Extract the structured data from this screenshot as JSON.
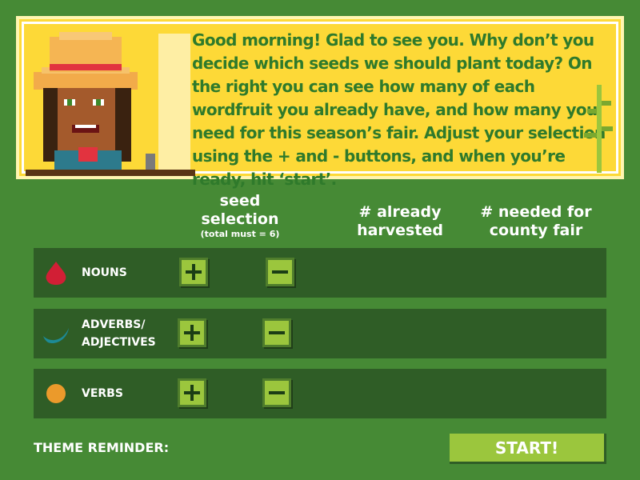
{
  "dialog": {
    "text": "Good morning! Glad to see you. Why don’t you decide which seeds we should plant today?  On the right you can see how many of each wordfruit you already have, and how many you need for this season’s fair. Adjust your selection using the + and - buttons, and when you’re ready, hit ‘start’."
  },
  "columns": {
    "seed_line1": "seed",
    "seed_line2": "selection",
    "seed_note": "(total must = 6)",
    "harvested_line1": "# already",
    "harvested_line2": "harvested",
    "needed_line1": "# needed for",
    "needed_line2": "county fair"
  },
  "rows": [
    {
      "label": "NOUNS",
      "icon": "red-drop-icon",
      "color": "#d11f35"
    },
    {
      "label_line1": "ADVERBS/",
      "label_line2": "ADJECTIVES",
      "icon": "teal-crescent-icon",
      "color": "#1d8a96"
    },
    {
      "label": "VERBS",
      "icon": "orange-circle-icon",
      "color": "#eb9a2b"
    }
  ],
  "controls": {
    "plus_icon": "plus-icon",
    "minus_icon": "minus-icon"
  },
  "footer": {
    "theme_label": "THEME REMINDER:",
    "start_label": "START!"
  },
  "colors": {
    "background": "#468a35",
    "row": "#2f5d26",
    "button": "#9bc63d",
    "dialog": "#fdd937",
    "dialog_text": "#2f7a2b"
  }
}
